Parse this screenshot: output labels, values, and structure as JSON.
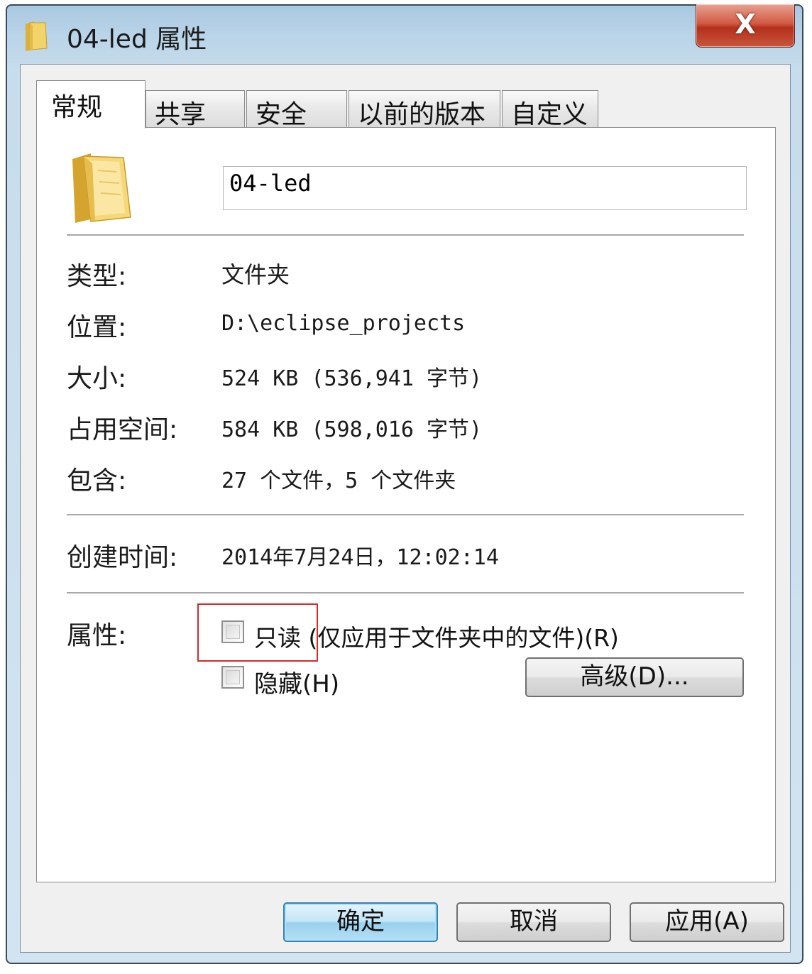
{
  "window": {
    "title": "04-led 属性",
    "close_glyph": "X"
  },
  "tabs": [
    {
      "label": "常规",
      "active": true
    },
    {
      "label": "共享",
      "active": false
    },
    {
      "label": "安全",
      "active": false
    },
    {
      "label": "以前的版本",
      "active": false
    },
    {
      "label": "自定义",
      "active": false
    }
  ],
  "general": {
    "folder_icon": "folder-icon",
    "name_value": "04-led",
    "type_label": "类型:",
    "type_value": "文件夹",
    "location_label": "位置:",
    "location_value": "D:\\eclipse_projects",
    "size_label": "大小:",
    "size_value": "524 KB (536,941 字节)",
    "disk_size_label": "占用空间:",
    "disk_size_value": "584 KB (598,016 字节)",
    "contains_label": "包含:",
    "contains_value": "27 个文件，5 个文件夹",
    "created_label": "创建时间:",
    "created_value": "2014年7月24日，12:02:14",
    "attributes_label": "属性:",
    "readonly_label": "只读 (仅应用于文件夹中的文件)(R)",
    "readonly_checked": false,
    "hidden_label": "隐藏(H)",
    "hidden_checked": false,
    "advanced_button": "高级(D)..."
  },
  "footer": {
    "ok_button": "确定",
    "cancel_button": "取消",
    "apply_button": "应用(A)"
  },
  "colors": {
    "highlight_box": "#d9292a",
    "title_bar": "#b9d3e8",
    "close_button": "#c9563c",
    "primary_button": "#98d1ef"
  }
}
